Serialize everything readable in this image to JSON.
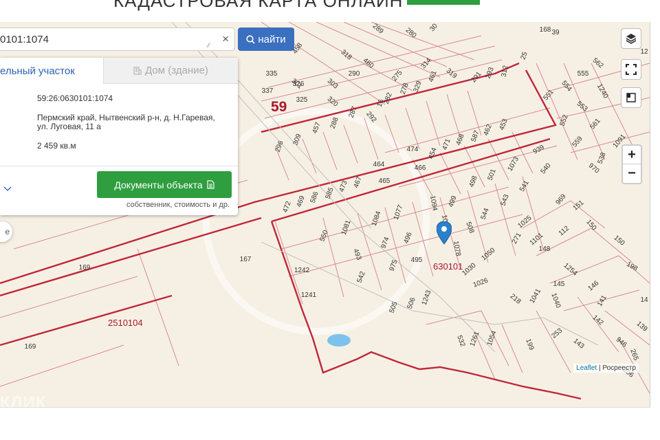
{
  "page": {
    "title": "КАДАСТРОВАЯ КАРТА ОНЛАЙН"
  },
  "search": {
    "value": "0101:1074",
    "clear_symbol": "×",
    "button_label": "найти"
  },
  "panel": {
    "tab_active": "ельный участок",
    "tab_inactive": "Дом (здание)",
    "cadastral_number": "59:26:0630101:1074",
    "address_line1": "Пермский край, Нытвенский р-н, д. Н.Гаревая,",
    "address_line2": "ул. Луговая, 11 а",
    "area": "2 459 кв.м",
    "docs_button": "Документы объекта",
    "docs_sub": "собственник, стоимость и др."
  },
  "map": {
    "pill_label": "е",
    "big_label": "59",
    "quarter_label": "630101",
    "quarter_label_2": "2510104",
    "watermark": "КЛИК",
    "attribution_link": "Leaflet",
    "attribution_sep": "|",
    "attribution_source": "Росреестр",
    "zoom_in": "+",
    "zoom_out": "−",
    "colors": {
      "boundary": "#c0263a",
      "background": "#f6f0e4",
      "water": "#6cb8e8",
      "marker": "#2a81cb",
      "accent_blue": "#3b6fc0",
      "accent_green": "#2e9e3e"
    },
    "icons": [
      "layers-icon",
      "fullscreen-icon",
      "area-select-icon",
      "search-icon",
      "document-icon",
      "house-icon",
      "chevron-down-icon",
      "map-marker-icon"
    ],
    "parcel_labels": [
      {
        "t": "458",
        "a": -55
      },
      {
        "t": "318",
        "a": 40
      },
      {
        "t": "460",
        "a": 40
      },
      {
        "t": "289",
        "a": 40
      },
      {
        "t": "280",
        "a": 40
      },
      {
        "t": "314",
        "a": -50
      },
      {
        "t": "30",
        "a": -50
      },
      {
        "t": "275",
        "a": -50
      },
      {
        "t": "291",
        "a": -50
      },
      {
        "t": "293",
        "a": -70
      },
      {
        "t": "312",
        "a": -80
      },
      {
        "t": "25",
        "a": -70
      },
      {
        "t": "168",
        "a": 0
      },
      {
        "t": "39",
        "a": 0
      },
      {
        "t": "335",
        "a": 0
      },
      {
        "t": "301",
        "a": 40
      },
      {
        "t": "303",
        "a": 40
      },
      {
        "t": "290",
        "a": 0
      },
      {
        "t": "337",
        "a": 0
      },
      {
        "t": "326",
        "a": 0
      },
      {
        "t": "320",
        "a": 40
      },
      {
        "t": "329",
        "a": -70
      },
      {
        "t": "461",
        "a": -70
      },
      {
        "t": "319",
        "a": 40
      },
      {
        "t": "278",
        "a": -70
      },
      {
        "t": "282",
        "a": -70
      },
      {
        "t": "16",
        "a": -70
      },
      {
        "t": "292",
        "a": 50
      },
      {
        "t": "325",
        "a": 0
      },
      {
        "t": "287",
        "a": -70
      },
      {
        "t": "288",
        "a": -70
      },
      {
        "t": "457",
        "a": -70
      },
      {
        "t": "309",
        "a": -70
      },
      {
        "t": "296",
        "a": -70
      },
      {
        "t": "562",
        "a": 40
      },
      {
        "t": "555",
        "a": 0
      },
      {
        "t": "551",
        "a": -50
      },
      {
        "t": "554",
        "a": 50
      },
      {
        "t": "553",
        "a": 40
      },
      {
        "t": "1240",
        "a": 60
      },
      {
        "t": "552",
        "a": -70
      },
      {
        "t": "561",
        "a": -50
      },
      {
        "t": "559",
        "a": -50
      },
      {
        "t": "1091",
        "a": -50
      },
      {
        "t": "538",
        "a": -70
      },
      {
        "t": "970",
        "a": 40
      },
      {
        "t": "453",
        "a": -70
      },
      {
        "t": "462",
        "a": -70
      },
      {
        "t": "587",
        "a": -70
      },
      {
        "t": "468",
        "a": -70
      },
      {
        "t": "471",
        "a": -70
      },
      {
        "t": "454",
        "a": -70
      },
      {
        "t": "474",
        "a": 0
      },
      {
        "t": "466",
        "a": 0
      },
      {
        "t": "939",
        "a": -30
      },
      {
        "t": "1073",
        "a": -60
      },
      {
        "t": "540",
        "a": -50
      },
      {
        "t": "501",
        "a": -70
      },
      {
        "t": "541",
        "a": -60
      },
      {
        "t": "498",
        "a": -70
      },
      {
        "t": "543",
        "a": -70
      },
      {
        "t": "544",
        "a": -70
      },
      {
        "t": "499",
        "a": -70
      },
      {
        "t": "1094",
        "a": 80
      },
      {
        "t": "1074",
        "a": 80
      },
      {
        "t": "508",
        "a": 70
      },
      {
        "t": "1078",
        "a": 80
      },
      {
        "t": "464",
        "a": 0
      },
      {
        "t": "465",
        "a": 0
      },
      {
        "t": "467",
        "a": -70
      },
      {
        "t": "473",
        "a": -70
      },
      {
        "t": "585",
        "a": -70
      },
      {
        "t": "586",
        "a": -70
      },
      {
        "t": "469",
        "a": -70
      },
      {
        "t": "472",
        "a": -70
      },
      {
        "t": "1081",
        "a": -70
      },
      {
        "t": "550",
        "a": -70
      },
      {
        "t": "1084",
        "a": -70
      },
      {
        "t": "1077",
        "a": -70
      },
      {
        "t": "496",
        "a": -70
      },
      {
        "t": "974",
        "a": -70
      },
      {
        "t": "493",
        "a": 70
      },
      {
        "t": "975",
        "a": -70
      },
      {
        "t": "495",
        "a": 0
      },
      {
        "t": "542",
        "a": -70
      },
      {
        "t": "1242",
        "a": 0
      },
      {
        "t": "1241",
        "a": 0
      },
      {
        "t": "167",
        "a": 0
      },
      {
        "t": "169",
        "a": 0
      },
      {
        "t": "169",
        "a": 0
      },
      {
        "t": "505",
        "a": -70
      },
      {
        "t": "506",
        "a": -70
      },
      {
        "t": "1243",
        "a": -70
      },
      {
        "t": "1050",
        "a": -40
      },
      {
        "t": "1030",
        "a": -40
      },
      {
        "t": "1026",
        "a": -20
      },
      {
        "t": "969",
        "a": -50
      },
      {
        "t": "151",
        "a": -40
      },
      {
        "t": "150",
        "a": 50
      },
      {
        "t": "112",
        "a": -40
      },
      {
        "t": "1025",
        "a": -40
      },
      {
        "t": "271",
        "a": -60
      },
      {
        "t": "1101",
        "a": -40
      },
      {
        "t": "148",
        "a": 0
      },
      {
        "t": "150",
        "a": 40
      },
      {
        "t": "1254",
        "a": 40
      },
      {
        "t": "198",
        "a": 30
      },
      {
        "t": "218",
        "a": 40
      },
      {
        "t": "1041",
        "a": -60
      },
      {
        "t": "1040",
        "a": 70
      },
      {
        "t": "145",
        "a": 0
      },
      {
        "t": "146",
        "a": -40
      },
      {
        "t": "141",
        "a": -60
      },
      {
        "t": "142",
        "a": 40
      },
      {
        "t": "253",
        "a": -40
      },
      {
        "t": "143",
        "a": 40
      },
      {
        "t": "532",
        "a": 70
      },
      {
        "t": "1261",
        "a": -70
      },
      {
        "t": "1054",
        "a": -70
      },
      {
        "t": "199",
        "a": 70
      },
      {
        "t": "946",
        "a": 40
      },
      {
        "t": "265",
        "a": 70
      },
      {
        "t": "206",
        "a": 40
      },
      {
        "t": "139",
        "a": 40
      },
      {
        "t": "14",
        "a": 0
      },
      {
        "t": "12",
        "a": 0
      }
    ]
  }
}
